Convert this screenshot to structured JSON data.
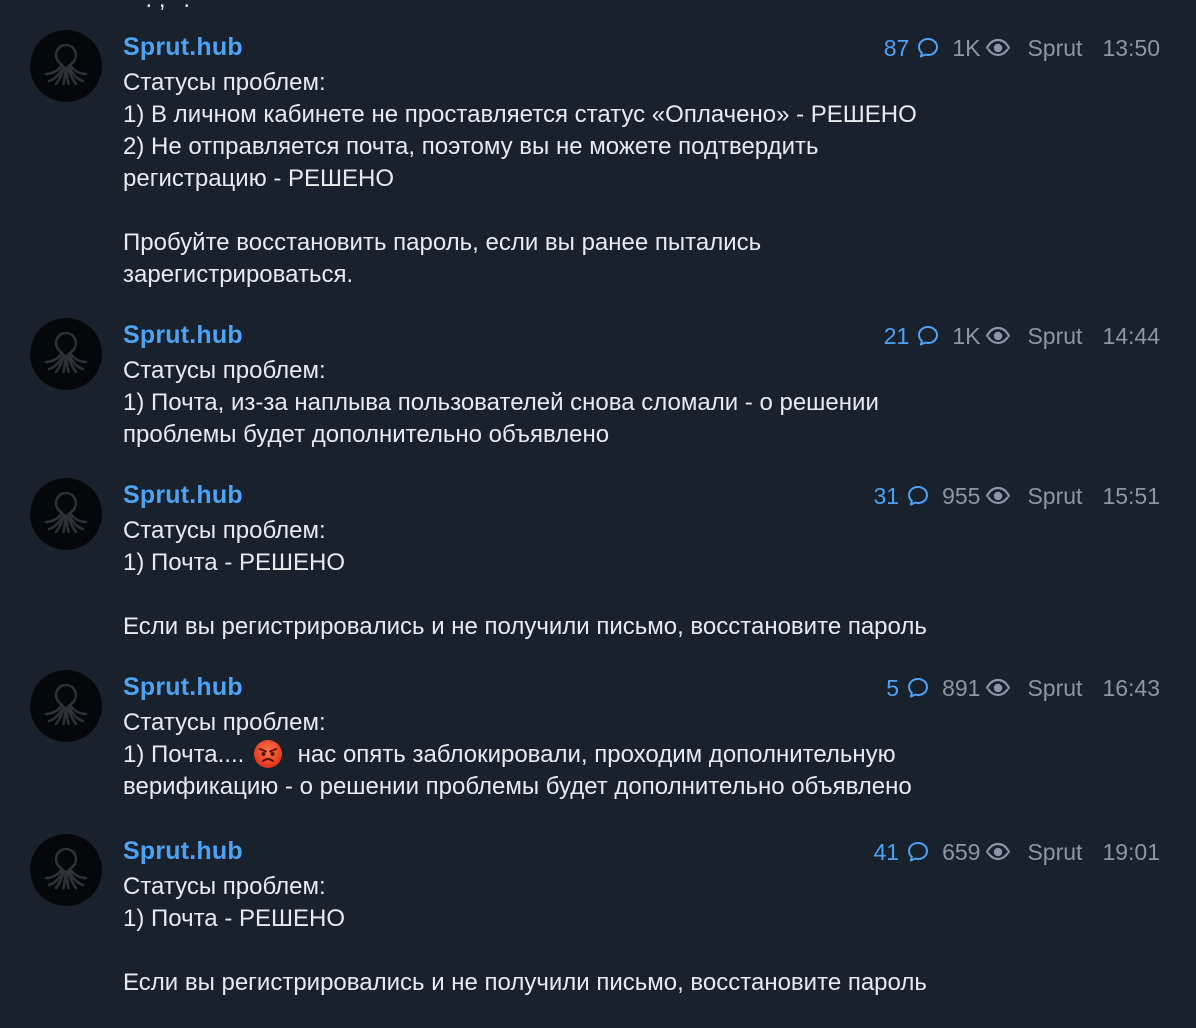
{
  "feed": {
    "partial_top_line": "' '   .  ,  '    . '",
    "posts": [
      {
        "author": "Sprut.hub",
        "comments": "87",
        "views": "1K",
        "signature": "Sprut",
        "time": "13:50",
        "lines": [
          "Статусы проблем:",
          "1) В личном кабинете не проставляется статус «Оплачено» - РЕШЕНО",
          "2) Не отправляется почта, поэтому вы не можете подтвердить",
          "регистрацию - РЕШЕНО",
          "",
          "Пробуйте восстановить пароль, если вы ранее пытались",
          "зарегистрироваться."
        ]
      },
      {
        "author": "Sprut.hub",
        "comments": "21",
        "views": "1K",
        "signature": "Sprut",
        "time": "14:44",
        "lines": [
          "Статусы проблем:",
          "1) Почта, из-за наплыва пользователей снова сломали - о решении",
          "проблемы будет дополнительно объявлено"
        ]
      },
      {
        "author": "Sprut.hub",
        "comments": "31",
        "views": "955",
        "signature": "Sprut",
        "time": "15:51",
        "lines": [
          "Статусы проблем:",
          "1) Почта - РЕШЕНО",
          "",
          "Если вы регистрировались и не получили письмо, восстановите пароль"
        ]
      },
      {
        "author": "Sprut.hub",
        "comments": "5",
        "views": "891",
        "signature": "Sprut",
        "time": "16:43",
        "lines": [
          "Статусы проблем:",
          "1) Почта.... 😡 нас опять заблокировали, проходим дополнительную",
          "верификацию - о решении проблемы будет дополнительно объявлено"
        ]
      },
      {
        "author": "Sprut.hub",
        "comments": "41",
        "views": "659",
        "signature": "Sprut",
        "time": "19:01",
        "lines": [
          "Статусы проблем:",
          "1) Почта - РЕШЕНО",
          "",
          "Если вы регистрировались и не получили письмо, восстановите пароль"
        ]
      }
    ]
  },
  "icons": {
    "comment": "comment-bubble-icon",
    "views": "eye-icon",
    "avatar": "octopus-logo"
  },
  "colors": {
    "background": "#18212c",
    "accent": "#4ea1f3",
    "text": "#e7ebf0",
    "muted": "#8b97a6"
  }
}
